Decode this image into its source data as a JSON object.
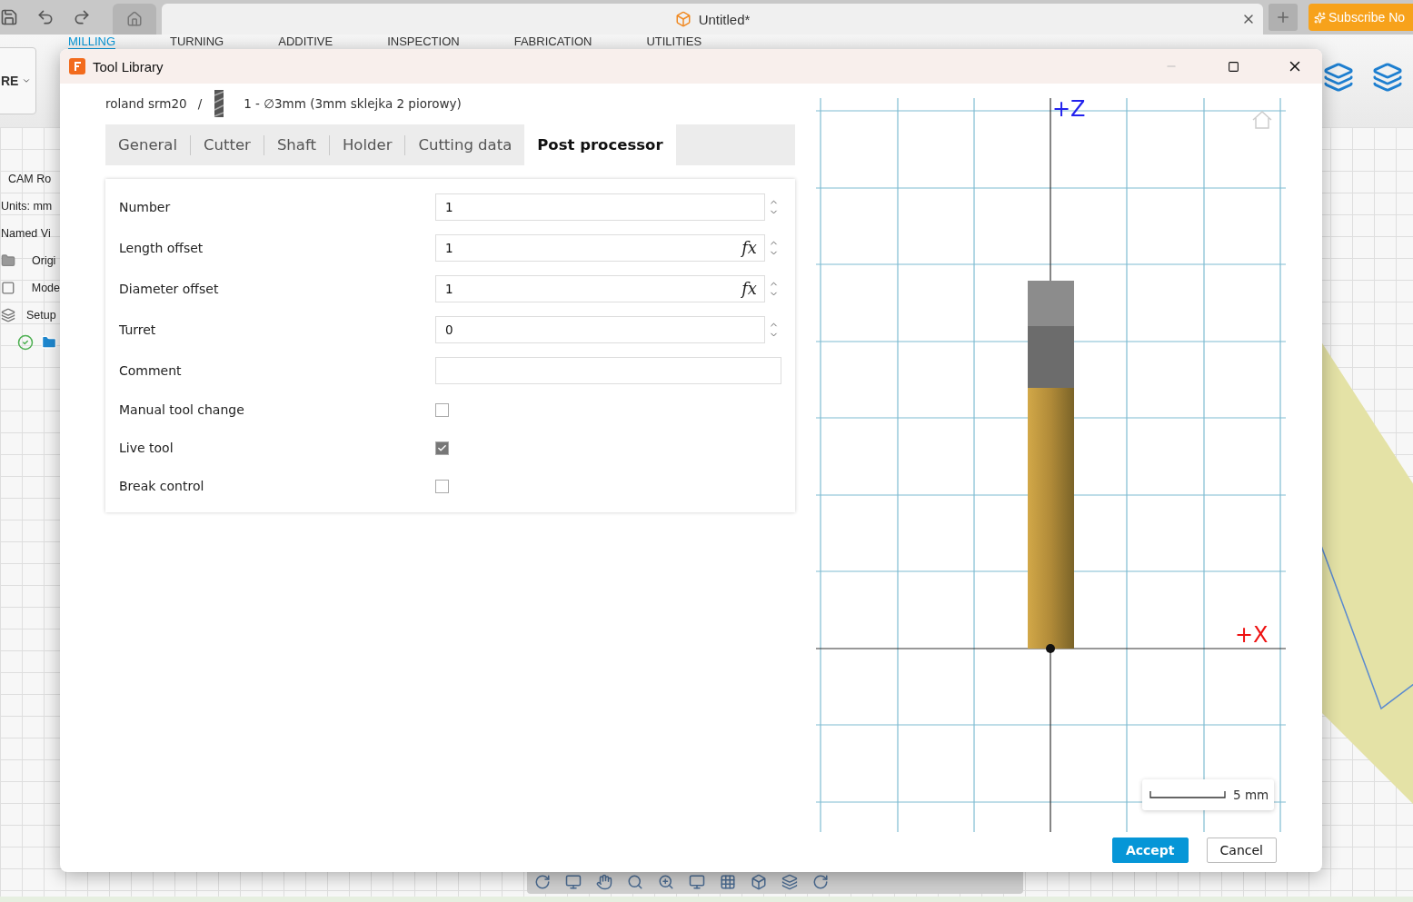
{
  "app": {
    "document_tab": "Untitled*",
    "subscribe": "Subscribe No",
    "ribbon_left": "RE",
    "ribbon_tabs": [
      {
        "label": "MILLING",
        "selected": true
      },
      {
        "label": "TURNING",
        "selected": false
      },
      {
        "label": "ADDITIVE",
        "selected": false
      },
      {
        "label": "INSPECTION",
        "selected": false
      },
      {
        "label": "FABRICATION",
        "selected": false
      },
      {
        "label": "UTILITIES",
        "selected": false
      }
    ],
    "browser_items": [
      {
        "label": "CAM Ro",
        "kind": "text"
      },
      {
        "label": "Units: mm",
        "kind": "text"
      },
      {
        "label": "Named Vi",
        "kind": "text"
      },
      {
        "label": "Origi",
        "kind": "folder"
      },
      {
        "label": "Mode",
        "kind": "model"
      },
      {
        "label": "Setup",
        "kind": "setup"
      }
    ]
  },
  "dialog": {
    "title": "Tool Library",
    "breadcrumb": {
      "library": "roland srm20",
      "separator": "/",
      "tool": "1 - ∅3mm (3mm sklejka 2 piorowy)"
    },
    "tabs": [
      {
        "label": "General",
        "selected": false
      },
      {
        "label": "Cutter",
        "selected": false
      },
      {
        "label": "Shaft",
        "selected": false
      },
      {
        "label": "Holder",
        "selected": false
      },
      {
        "label": "Cutting data",
        "selected": false
      },
      {
        "label": "Post processor",
        "selected": true
      }
    ],
    "fields": [
      {
        "label": "Number",
        "kind": "spin",
        "value": "1"
      },
      {
        "label": "Length offset",
        "kind": "formula",
        "value": "1",
        "formula": "fx"
      },
      {
        "label": "Diameter offset",
        "kind": "formula",
        "value": "1",
        "formula": "fx"
      },
      {
        "label": "Turret",
        "kind": "spin",
        "value": "0"
      },
      {
        "label": "Comment",
        "kind": "text"
      },
      {
        "label": "Manual tool change",
        "kind": "checkbox",
        "checked": false
      },
      {
        "label": "Live tool",
        "kind": "checkbox",
        "checked": true
      },
      {
        "label": "Break control",
        "kind": "checkbox",
        "checked": false
      }
    ],
    "preview": {
      "z_label": "+Z",
      "x_label": "+X",
      "scale": "5 mm"
    },
    "buttons": [
      {
        "label": "Accept",
        "kind": "primary"
      },
      {
        "label": "Cancel",
        "kind": "secondary"
      }
    ]
  }
}
